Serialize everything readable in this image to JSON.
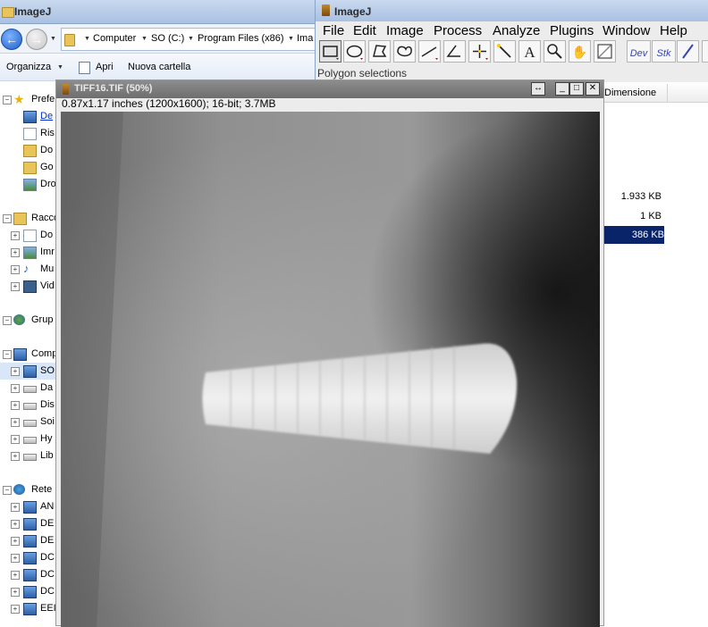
{
  "explorer": {
    "title": "ImageJ",
    "breadcrumb": [
      "Computer",
      "SO (C:)",
      "Program Files (x86)",
      "Ima"
    ],
    "commands": {
      "organize": "Organizza",
      "open": "Apri",
      "new_folder": "Nuova cartella"
    },
    "tree": [
      {
        "label": "Prefe",
        "icon": "star-icon",
        "group": true
      },
      {
        "label": "De",
        "icon": "desktop-icon"
      },
      {
        "label": "Ris",
        "icon": "recent-icon"
      },
      {
        "label": "Do",
        "icon": "folder-icon"
      },
      {
        "label": "Go",
        "icon": "folder-icon"
      },
      {
        "label": "Dro",
        "icon": "dropbox-icon"
      },
      {
        "label": "Racco",
        "icon": "library-icon",
        "group": true
      },
      {
        "label": "Do",
        "icon": "documents-icon"
      },
      {
        "label": "Imr",
        "icon": "pictures-icon"
      },
      {
        "label": "Mu",
        "icon": "music-icon"
      },
      {
        "label": "Vid",
        "icon": "video-icon"
      },
      {
        "label": "Grup",
        "icon": "homegroup-icon",
        "group": true
      },
      {
        "label": "Comp",
        "icon": "computer-icon",
        "group": true
      },
      {
        "label": "SO",
        "icon": "system-drive-icon",
        "selected": true
      },
      {
        "label": "Da",
        "icon": "drive-icon"
      },
      {
        "label": "Dis",
        "icon": "drive-icon"
      },
      {
        "label": "Soi",
        "icon": "drive-icon"
      },
      {
        "label": "Hy",
        "icon": "network-drive-disconnected-icon"
      },
      {
        "label": "Lib",
        "icon": "drive-icon"
      },
      {
        "label": "Rete",
        "icon": "network-icon",
        "group": true
      },
      {
        "label": "AN",
        "icon": "computer-icon"
      },
      {
        "label": "DE",
        "icon": "computer-icon"
      },
      {
        "label": "DE",
        "icon": "computer-icon"
      },
      {
        "label": "DC",
        "icon": "computer-icon"
      },
      {
        "label": "DC",
        "icon": "computer-icon"
      },
      {
        "label": "DC",
        "icon": "computer-icon"
      },
      {
        "label": "EEI",
        "icon": "computer-icon"
      }
    ]
  },
  "imagej": {
    "title": "ImageJ",
    "menu": [
      "File",
      "Edit",
      "Image",
      "Process",
      "Analyze",
      "Plugins",
      "Window",
      "Help"
    ],
    "tools": [
      "rectangle-tool",
      "oval-tool",
      "polygon-tool",
      "freehand-tool",
      "line-tool",
      "angle-tool",
      "point-tool",
      "wand-tool",
      "text-tool",
      "magnifier-tool",
      "hand-tool",
      "color-picker-tool"
    ],
    "dev_label": "Dev",
    "stk_label": "Stk",
    "status": "Polygon selections"
  },
  "filelist": {
    "column_header": "Dimensione",
    "sizes": [
      "1.933 KB",
      "1 KB",
      "386 KB"
    ],
    "selected_index": 2
  },
  "image_window": {
    "title": "TIFF16.TIF (50%)",
    "info": "0.87x1.17 inches (1200x1600); 16-bit; 3.7MB"
  },
  "colors": {
    "title_active": "#a9c1e2",
    "title_inactive": "#6e6e6e",
    "selection": "#0a246a"
  }
}
